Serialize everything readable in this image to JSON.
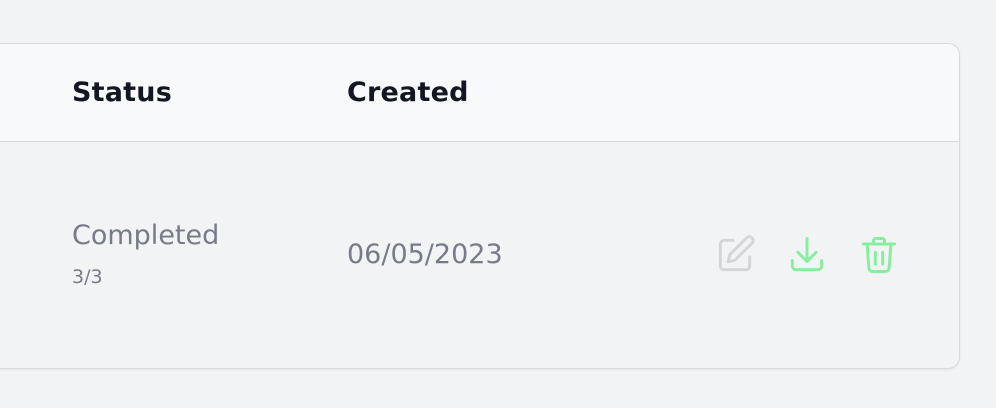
{
  "table": {
    "headers": {
      "status": "Status",
      "created": "Created"
    },
    "rows": [
      {
        "status": "Completed",
        "progress": "3/3",
        "created": "06/05/2023",
        "actions": {
          "edit_icon": "edit-icon",
          "download_icon": "download-icon",
          "delete_icon": "trash-icon"
        }
      }
    ]
  },
  "colors": {
    "edit_disabled": "#d4d5d8",
    "action_green": "#86ef9e",
    "header_text": "#131722",
    "cell_text": "#767b85"
  }
}
